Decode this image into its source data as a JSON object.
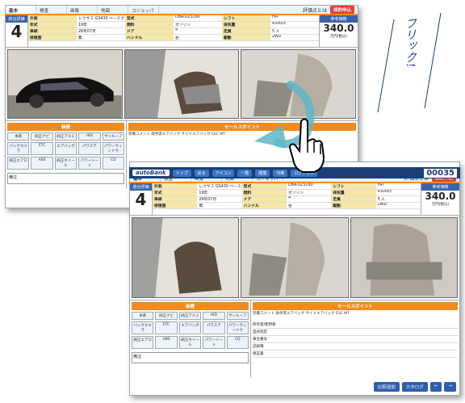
{
  "window_back": {
    "tabs": [
      "基本",
      "検査",
      "画像",
      "地図",
      "コジョッパ"
    ],
    "tab_right_text": "評価点とは",
    "tab_badge": "成約申込",
    "grade": {
      "label": "総合評価",
      "value": "4"
    },
    "info_pairs": [
      [
        "外装",
        "レクサス GS430 ベースグレード"
      ],
      [
        "型式",
        "DBA-UZS190"
      ],
      [
        "シフト",
        "FAT"
      ],
      [
        "年式",
        "19年"
      ],
      [
        "燃料",
        "ガソリン"
      ],
      [
        "排気量",
        "4300cc"
      ],
      [
        "車検",
        "26年07月"
      ],
      [
        "ドア",
        "4"
      ],
      [
        "定員",
        "5 人"
      ],
      [
        "修復歴",
        "無"
      ],
      [
        "ハンドル",
        "右"
      ],
      [
        "駆動",
        "2WD"
      ]
    ],
    "price": {
      "label": "参考価格",
      "value": "340.0",
      "unit": "万円(税込)"
    },
    "equipment_header": "装備",
    "equipment": [
      "本革",
      "純正ナビ",
      "純正アルミ",
      "HID",
      "サンルーフ",
      "バックカメラ",
      "ETC",
      "エアバッグ",
      "パワステ",
      "パワーウィンドウ",
      "純正エアロ",
      "ABS",
      "純正ホイール",
      "パワーシート",
      "CD"
    ],
    "memo": "備注",
    "sales_header": "セールスポイント",
    "sales_text": "装備コメント 助手席エアバッグ サイドエアバッグ ESC MT"
  },
  "window_front": {
    "toolbar": {
      "logo": "autoBank",
      "buttons": [
        "トップ",
        "戻る",
        "アイコン",
        "一覧",
        "閲覧",
        "印刷",
        "ログアウト"
      ],
      "counter": "00035"
    },
    "tabs": [
      "基本",
      "検査",
      "画像",
      "地図",
      "コジョッパ"
    ],
    "tab_right_text": "評価点とは",
    "tab_badge": "成約申込",
    "grade": {
      "label": "総合評価",
      "value": "4"
    },
    "info_pairs": [
      [
        "外装",
        "レクサス GS430 ベースグレード"
      ],
      [
        "型式",
        "DBA-UZS190"
      ],
      [
        "シフト",
        "FAT"
      ],
      [
        "年式",
        "19年"
      ],
      [
        "燃料",
        "ガソリン"
      ],
      [
        "排気量",
        "4300cc"
      ],
      [
        "車検",
        "26年07月"
      ],
      [
        "ドア",
        "4"
      ],
      [
        "定員",
        "5 人"
      ],
      [
        "修復歴",
        "無"
      ],
      [
        "ハンドル",
        "右"
      ],
      [
        "駆動",
        "2WD"
      ]
    ],
    "price": {
      "label": "参考価格",
      "value": "340.0",
      "unit": "万円(税込)"
    },
    "equipment_header": "装備",
    "equipment": [
      "本革",
      "純正ナビ",
      "純正アルミ",
      "HID",
      "サンルーフ",
      "バックカメラ",
      "ETC",
      "エアバッグ",
      "パワステ",
      "パワーウィンドウ",
      "純正エアロ",
      "ABS",
      "純正ホイール",
      "パワーシート",
      "CD"
    ],
    "memo": "備注",
    "sales_header": "セールスポイント",
    "sales_text": "装備コメント 助手席エアバッグ サイドエアバッグ ESC MT",
    "detail_rows": [
      "所有者/使用者",
      "型式指定",
      "車台番号",
      "記録簿",
      "保証書"
    ],
    "bottom_buttons": [
      "比較追加",
      "カタログ",
      "←",
      "→"
    ]
  },
  "annotation": "フリック!"
}
